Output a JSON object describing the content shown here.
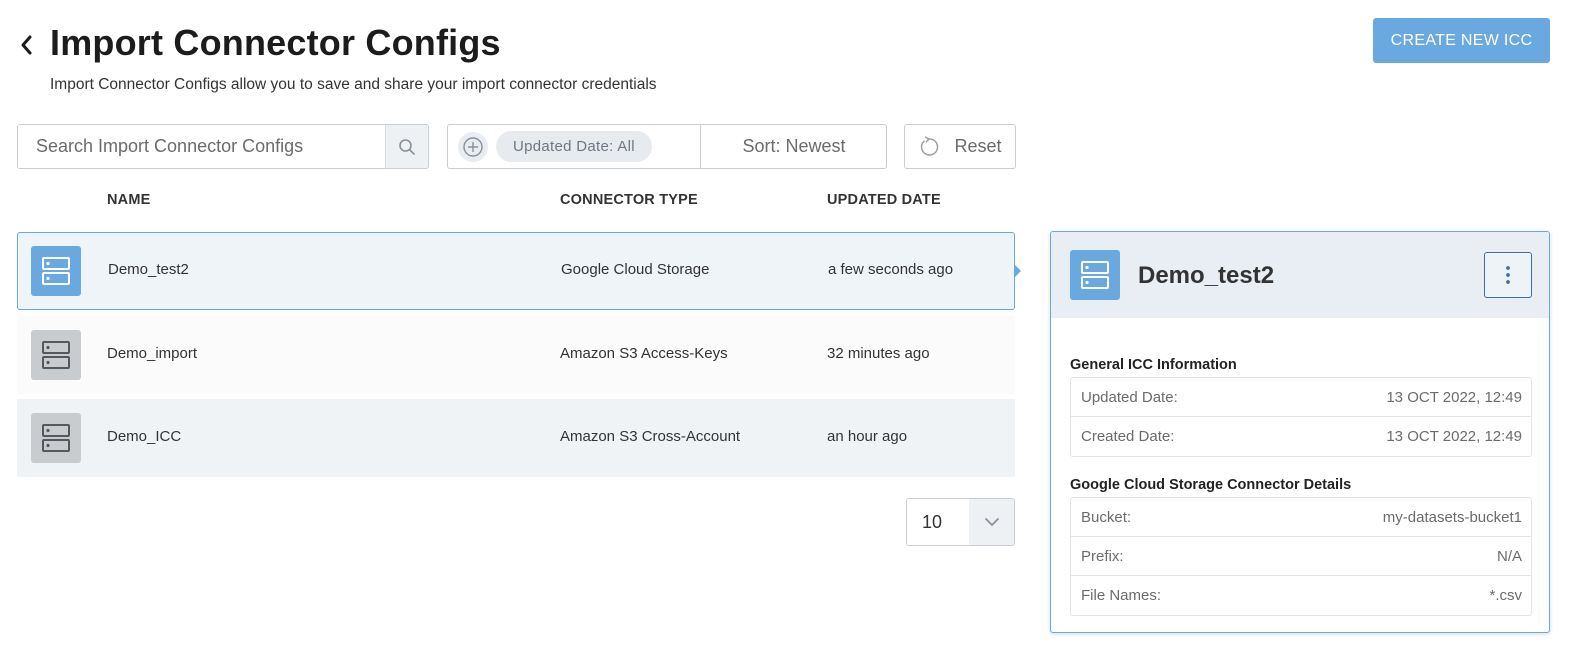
{
  "header": {
    "title": "Import Connector Configs",
    "subtitle": "Import Connector Configs allow you to save and share your import connector credentials",
    "create_label": "CREATE NEW ICC"
  },
  "toolbar": {
    "search_placeholder": "Search Import Connector Configs",
    "filter_chip": "Updated Date: All",
    "sort_label": "Sort: Newest",
    "reset_label": "Reset"
  },
  "table": {
    "columns": [
      "NAME",
      "CONNECTOR TYPE",
      "UPDATED DATE"
    ],
    "rows": [
      {
        "name": "Demo_test2",
        "type": "Google Cloud Storage",
        "updated": "a few seconds ago"
      },
      {
        "name": "Demo_import",
        "type": "Amazon S3 Access-Keys",
        "updated": "32 minutes ago"
      },
      {
        "name": "Demo_ICC",
        "type": "Amazon S3 Cross-Account",
        "updated": "an hour ago"
      }
    ]
  },
  "pagination": {
    "page_size": "10"
  },
  "detail": {
    "title": "Demo_test2",
    "general_title": "General ICC Information",
    "general": [
      {
        "label": "Updated Date:",
        "value": "13 OCT 2022, 12:49"
      },
      {
        "label": "Created Date:",
        "value": "13 OCT 2022, 12:49"
      }
    ],
    "connector_title": "Google Cloud Storage Connector Details",
    "connector": [
      {
        "label": "Bucket:",
        "value": "my-datasets-bucket1"
      },
      {
        "label": "Prefix:",
        "value": "N/A"
      },
      {
        "label": "File Names:",
        "value": "*.csv"
      }
    ]
  },
  "colors": {
    "accent": "#6aa9e0",
    "selected_row_bg": "#eff4f9",
    "inactive_icon_bg": "#c8cccf"
  },
  "icons": [
    "back-icon",
    "search-icon",
    "add-filter-icon",
    "reset-icon",
    "server-icon",
    "chevron-down-icon",
    "more-vertical-icon"
  ]
}
